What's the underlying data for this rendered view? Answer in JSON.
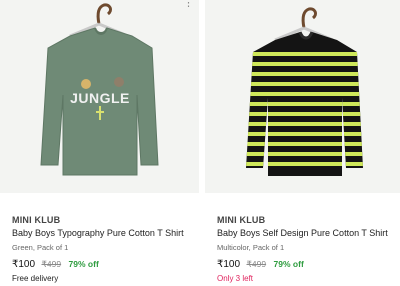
{
  "products": [
    {
      "brand": "MINI KLUB",
      "title": "Baby Boys Typography Pure Cotton T Shirt",
      "variant": "Green, Pack of 1",
      "price": "₹100",
      "mrp": "₹499",
      "discount": "79% off",
      "note": "Free delivery",
      "image_text": "JUNGLE",
      "colors": {
        "shirt": "#6f8a76",
        "print": "#f1f1f1"
      }
    },
    {
      "brand": "MINI KLUB",
      "title": "Baby Boys Self Design Pure Cotton T Shirt",
      "variant": "Multicolor, Pack of 1",
      "price": "₹100",
      "mrp": "₹499",
      "discount": "79% off",
      "note": "Only 3 left",
      "colors": {
        "shirt": "#141414",
        "stripe": "#cfe85a"
      }
    }
  ],
  "colors": {
    "discount": "#2e9c3f",
    "urgency": "#e0245e"
  },
  "icons": {
    "menu": "more-vertical-icon",
    "hanger": "hanger-icon"
  }
}
